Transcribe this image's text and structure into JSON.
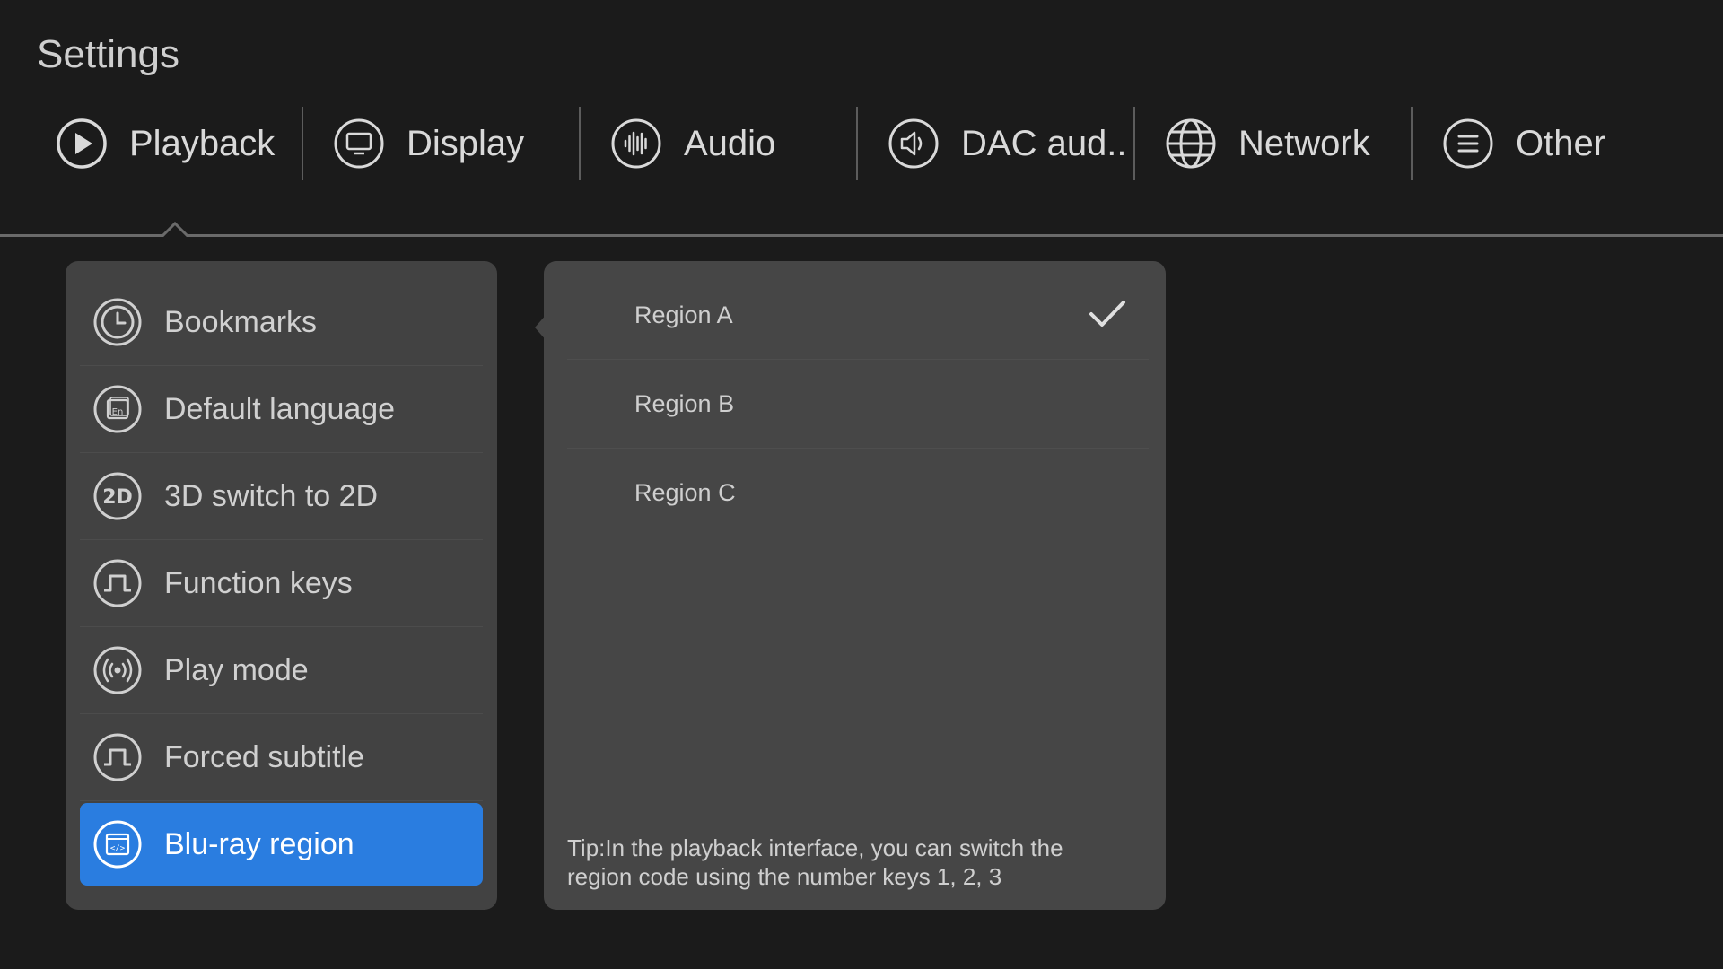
{
  "page": {
    "title": "Settings"
  },
  "tabs": [
    {
      "label": "Playback",
      "icon": "play-icon",
      "active": true
    },
    {
      "label": "Display",
      "icon": "monitor-icon"
    },
    {
      "label": "Audio",
      "icon": "audio-wave-icon"
    },
    {
      "label": "DAC aud..",
      "icon": "speaker-icon"
    },
    {
      "label": "Network",
      "icon": "globe-icon"
    },
    {
      "label": "Other",
      "icon": "menu-lines-icon"
    }
  ],
  "menu": {
    "items": [
      {
        "label": "Bookmarks",
        "icon": "clock-icon"
      },
      {
        "label": "Default language",
        "icon": "language-icon"
      },
      {
        "label": "3D switch to 2D",
        "icon": "2d-icon"
      },
      {
        "label": "Function keys",
        "icon": "pulse-icon"
      },
      {
        "label": "Play mode",
        "icon": "broadcast-icon"
      },
      {
        "label": "Forced subtitle",
        "icon": "pulse-icon"
      },
      {
        "label": "Blu-ray region",
        "icon": "code-window-icon",
        "selected": true
      }
    ]
  },
  "options": {
    "items": [
      {
        "label": "Region A",
        "checked": true
      },
      {
        "label": "Region B",
        "checked": false
      },
      {
        "label": "Region C",
        "checked": false
      }
    ],
    "tip": "Tip:In the playback interface, you can switch the region code using the number keys 1, 2, 3"
  },
  "colors": {
    "background": "#1b1b1b",
    "panel": "#424242",
    "selected": "#2a7de0"
  }
}
